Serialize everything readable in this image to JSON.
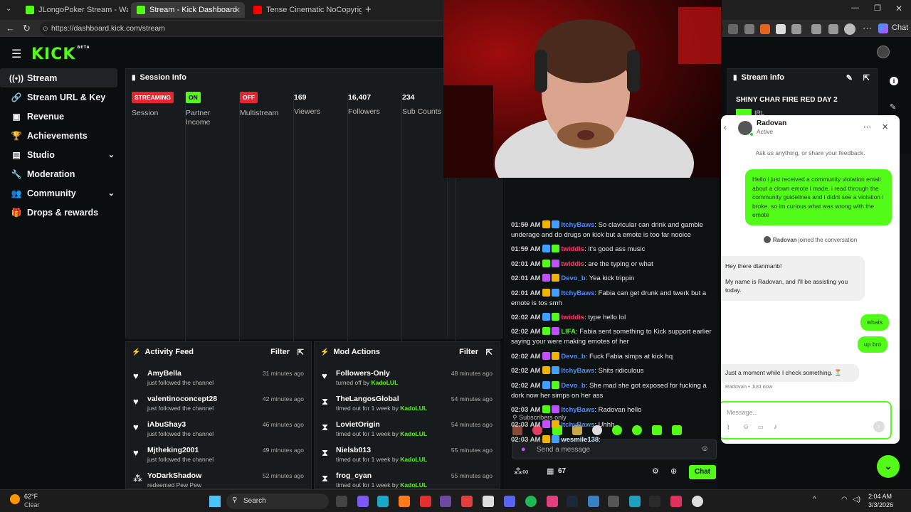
{
  "browser": {
    "tabs": [
      {
        "title": "JLongoPoker Stream - Watch"
      },
      {
        "title": "Stream - Kick Dashboard"
      },
      {
        "title": "Tense Cinematic NoCopyrigh"
      }
    ],
    "url": "https://dashboard.kick.com/stream",
    "copilot_label": "Chat"
  },
  "app": {
    "logo": "KICK",
    "logo_tag": "BETA",
    "sidebar": [
      {
        "label": "Stream",
        "icon": "broadcast-icon"
      },
      {
        "label": "Stream URL & Key",
        "icon": "link-icon"
      },
      {
        "label": "Revenue",
        "icon": "revenue-icon"
      },
      {
        "label": "Achievements",
        "icon": "trophy-icon"
      },
      {
        "label": "Studio",
        "icon": "studio-icon"
      },
      {
        "label": "Moderation",
        "icon": "wrench-icon"
      },
      {
        "label": "Community",
        "icon": "community-icon"
      },
      {
        "label": "Drops & rewards",
        "icon": "gift-icon"
      }
    ],
    "session": {
      "title": "Session Info",
      "stats": [
        {
          "badge": "STREAMING",
          "label": "Session"
        },
        {
          "badge": "ON",
          "label": "Partner Income"
        },
        {
          "badge": "OFF",
          "label": "Multistream"
        },
        {
          "value": "169",
          "label": "Viewers"
        },
        {
          "value": "16,407",
          "label": "Followers"
        },
        {
          "value": "234",
          "label": "Sub Counts"
        }
      ]
    },
    "stream_info": {
      "title": "Stream info",
      "stream_title": "SHINY CHAR FIRE RED DAY 2",
      "category": "IRL"
    },
    "activity": {
      "title": "Activity Feed",
      "filter": "Filter",
      "items": [
        {
          "name": "AmyBella",
          "sub": "just followed the channel",
          "time": "31 minutes ago"
        },
        {
          "name": "valentinoconcept28",
          "sub": "just followed the channel",
          "time": "42 minutes ago"
        },
        {
          "name": "iAbuShay3",
          "sub": "just followed the channel",
          "time": "46 minutes ago"
        },
        {
          "name": "Mjtheking2001",
          "sub": "just followed the channel",
          "time": "49 minutes ago"
        },
        {
          "name": "YoDarkShadow",
          "sub": "redeemed Pew Pew",
          "time": "52 minutes ago"
        }
      ]
    },
    "mod_actions": {
      "title": "Mod Actions",
      "filter": "Filter",
      "items": [
        {
          "name": "Followers-Only",
          "sub": "turned off by",
          "by": "KadoLUL",
          "time": "48 minutes ago",
          "icon": "heart-icon"
        },
        {
          "name": "TheLangosGlobal",
          "sub": "timed out for 1 week by",
          "by": "KadoLUL",
          "time": "54 minutes ago",
          "icon": "hourglass-icon"
        },
        {
          "name": "LovietOrigin",
          "sub": "timed out for 1 week by",
          "by": "KadoLUL",
          "time": "54 minutes ago",
          "icon": "hourglass-icon"
        },
        {
          "name": "Nielsb013",
          "sub": "timed out for 1 week by",
          "by": "KadoLUL",
          "time": "55 minutes ago",
          "icon": "hourglass-icon"
        },
        {
          "name": "frog_cyan",
          "sub": "timed out for 1 week by",
          "by": "KadoLUL",
          "time": "55 minutes ago",
          "icon": "hourglass-icon"
        }
      ]
    },
    "chat": {
      "messages": [
        {
          "time": "01:59 AM",
          "user": "ItchyBaws",
          "color": "#4d8cff",
          "text": "So clavicular can drink and gamble underage and do drugs on kick but a emote is too far nooice"
        },
        {
          "time": "01:59 AM",
          "user": "twiddis",
          "color": "#ff3b6b",
          "text": "it's good ass music"
        },
        {
          "time": "02:01 AM",
          "user": "twiddis",
          "color": "#ff3b6b",
          "text": "are the typing or what"
        },
        {
          "time": "02:01 AM",
          "user": "Devo_b",
          "color": "#4d8cff",
          "text": "Yea kick trippin"
        },
        {
          "time": "02:01 AM",
          "user": "ItchyBaws",
          "color": "#4d8cff",
          "text": "Fabia can get drunk and twerk but a emote is tos smh"
        },
        {
          "time": "02:02 AM",
          "user": "twiddis",
          "color": "#ff3b6b",
          "text": "type hello lol"
        },
        {
          "time": "02:02 AM",
          "user": "LIFA",
          "color": "#53fc18",
          "text": "Fabia sent something to Kick support earlier saying your were making emotes of her"
        },
        {
          "time": "02:02 AM",
          "user": "Devo_b",
          "color": "#4d8cff",
          "text": "Fuck Fabia simps at kick hq"
        },
        {
          "time": "02:02 AM",
          "user": "ItchyBaws",
          "color": "#4d8cff",
          "text": "Shits ridiculous"
        },
        {
          "time": "02:02 AM",
          "user": "Devo_b",
          "color": "#4d8cff",
          "text": "She mad she got exposed for fucking a dork now her simps on her ass"
        },
        {
          "time": "02:03 AM",
          "user": "ItchyBaws",
          "color": "#4d8cff",
          "text": "Radovan hello"
        },
        {
          "time": "02:03 AM",
          "user": "ItchyBaws",
          "color": "#4d8cff",
          "text": "Uhhh"
        },
        {
          "time": "02:03 AM",
          "user": "wesmile138",
          "color": "#cfe8ff",
          "text": ""
        }
      ],
      "subscribers_only": "Subscribers only",
      "placeholder": "Send a message",
      "viewer_count": "67",
      "chat_button": "Chat"
    }
  },
  "support": {
    "agent_name": "Radovan",
    "agent_status": "Active",
    "intro": "Ask us anything, or share your feedback.",
    "user_message": "Hello i just received a community violation email about a clown emote i made. i read through the community guidelines and i didnt see a violation i broke. so im curious what was wrong with the emote",
    "joined_name": "Radovan",
    "joined_text": "joined the conversation",
    "agent_greeting_1": "Hey there dtanmanb!",
    "agent_greeting_2": "My name is Radovan, and I'll be assisting you today.",
    "user_reply_1": "whats",
    "user_reply_2": "up bro",
    "agent_wait": "Just a moment while I check something. ⏳",
    "agent_meta": "Radovan • Just now",
    "message_placeholder": "Message..."
  },
  "taskbar": {
    "weather_temp": "62°F",
    "weather_desc": "Clear",
    "search": "Search",
    "time": "2:04 AM",
    "date": "3/3/2026"
  },
  "colors": {
    "brand": "#53fc18",
    "streaming": "#e3262f",
    "off": "#e3262f"
  }
}
